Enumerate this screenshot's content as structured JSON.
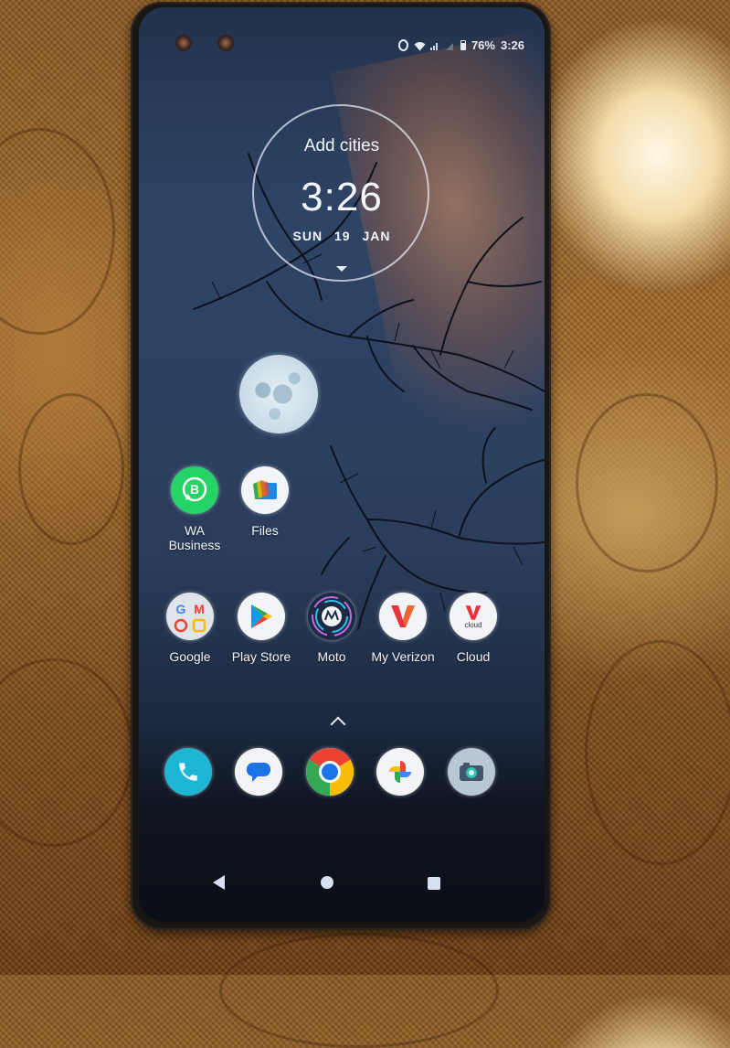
{
  "device": {
    "type": "android-phone",
    "surface": "gold embossed tablecloth"
  },
  "status_bar": {
    "icons": [
      "vibrate-icon",
      "wifi-icon",
      "signal-icon",
      "no-signal-icon",
      "battery-icon"
    ],
    "battery_percent": "76%",
    "time": "3:26"
  },
  "clock_widget": {
    "title": "Add cities",
    "time": "3:26",
    "day": "SUN",
    "date": "19",
    "month": "JAN",
    "expand_icon": "chevron-down-icon"
  },
  "wallpaper": {
    "description": "Bare tree branches with full moon on dark blue sky",
    "moon": "full-moon"
  },
  "home_apps_row1": [
    {
      "label": "WA\nBusiness",
      "icon": "whatsapp-business-icon",
      "color": "#25d366"
    },
    {
      "label": "Files",
      "icon": "files-icon",
      "color": "#f2f4f7"
    }
  ],
  "home_apps_row2": [
    {
      "label": "Google",
      "icon": "google-folder-icon",
      "color": "#e6e8ee"
    },
    {
      "label": "Play Store",
      "icon": "play-store-icon",
      "color": "#f2f4f7"
    },
    {
      "label": "Moto",
      "icon": "moto-icon",
      "color": "#1d2a44"
    },
    {
      "label": "My Verizon",
      "icon": "verizon-icon",
      "color": "#f2f4f7"
    },
    {
      "label": "Cloud",
      "icon": "verizon-cloud-icon",
      "color": "#f2f4f7",
      "sublabel": "cloud"
    }
  ],
  "app_drawer_hint": "chevron-up-icon",
  "dock": [
    {
      "name": "Phone",
      "icon": "phone-icon",
      "color": "#1fb6d6"
    },
    {
      "name": "Messages",
      "icon": "messages-icon",
      "color": "#f2f4f7"
    },
    {
      "name": "Chrome",
      "icon": "chrome-icon",
      "color": "#ffffff"
    },
    {
      "name": "Photos",
      "icon": "photos-icon",
      "color": "#f2f4f7"
    },
    {
      "name": "Camera",
      "icon": "camera-icon",
      "color": "#b9c7d4"
    }
  ],
  "nav_bar": {
    "back": "back-icon",
    "home": "home-icon",
    "recents": "recents-icon"
  }
}
